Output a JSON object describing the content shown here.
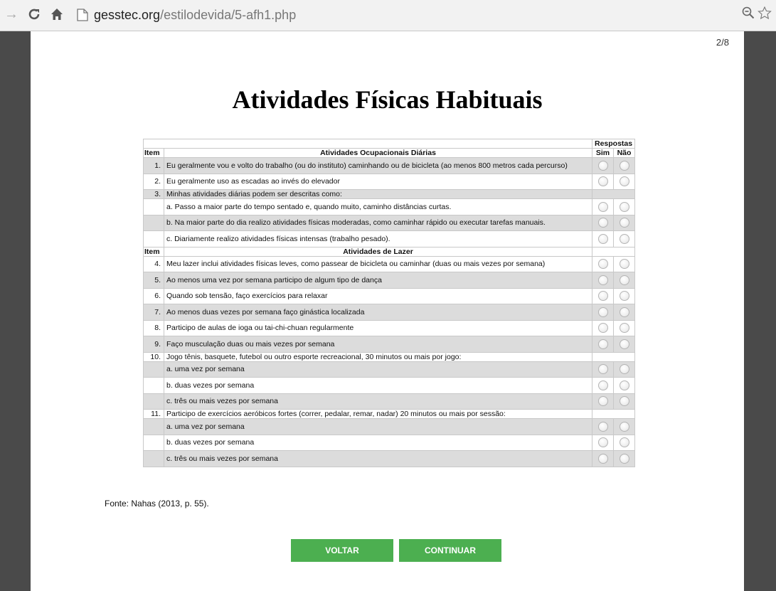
{
  "browser": {
    "url_host": "gesstec.org",
    "url_path": "/estilodevida/5-afh1.php"
  },
  "page": {
    "page_number": "2/8",
    "title": "Atividades Físicas Habituais",
    "source": "Fonte: Nahas (2013, p. 55).",
    "back_button": "VOLTAR",
    "continue_button": "CONTINUAR"
  },
  "table": {
    "respostas": "Respostas",
    "item_label": "Item",
    "sim": "Sim",
    "nao": "Não",
    "section1_title": "Atividades Ocupacionais Diárias",
    "section2_title": "Atividades de Lazer",
    "rows1": [
      {
        "num": "1.",
        "text": "Eu geralmente vou e volto do trabalho (ou do instituto) caminhando ou de bicicleta (ao menos 800 metros cada percurso)"
      },
      {
        "num": "2.",
        "text": "Eu geralmente uso as escadas ao invés do elevador"
      },
      {
        "num": "3.",
        "text": "Minhas atividades diárias podem ser descritas como:"
      },
      {
        "num": "",
        "text": "a. Passo a maior parte do tempo sentado e, quando muito, caminho distâncias curtas."
      },
      {
        "num": "",
        "text": "b. Na maior parte do dia realizo atividades físicas moderadas, como caminhar rápido ou executar tarefas manuais."
      },
      {
        "num": "",
        "text": "c. Diariamente realizo atividades físicas intensas (trabalho pesado)."
      }
    ],
    "rows2": [
      {
        "num": "4.",
        "text": "Meu lazer inclui atividades físicas leves, como passear de bicicleta ou caminhar (duas ou mais vezes por semana)"
      },
      {
        "num": "5.",
        "text": "Ao menos uma vez por semana participo de algum tipo de dança"
      },
      {
        "num": "6.",
        "text": "Quando sob tensão, faço exercícios para relaxar"
      },
      {
        "num": "7.",
        "text": "Ao menos duas vezes por semana faço ginástica localizada"
      },
      {
        "num": "8.",
        "text": "Participo de aulas de ioga ou tai-chi-chuan regularmente"
      },
      {
        "num": "9.",
        "text": "Faço musculação duas ou mais vezes por semana"
      },
      {
        "num": "10.",
        "text": "Jogo tênis, basquete, futebol ou outro esporte recreacional, 30 minutos ou mais por jogo:"
      },
      {
        "num": "",
        "text": "a. uma vez por semana"
      },
      {
        "num": "",
        "text": "b. duas vezes por semana"
      },
      {
        "num": "",
        "text": "c. três ou mais vezes por semana"
      },
      {
        "num": "11.",
        "text": "Participo de exercícios aeróbicos fortes (correr, pedalar, remar, nadar) 20 minutos ou mais por sessão:"
      },
      {
        "num": "",
        "text": "a. uma vez por semana"
      },
      {
        "num": "",
        "text": "b. duas vezes por semana"
      },
      {
        "num": "",
        "text": "c. três ou mais vezes por semana"
      }
    ]
  }
}
